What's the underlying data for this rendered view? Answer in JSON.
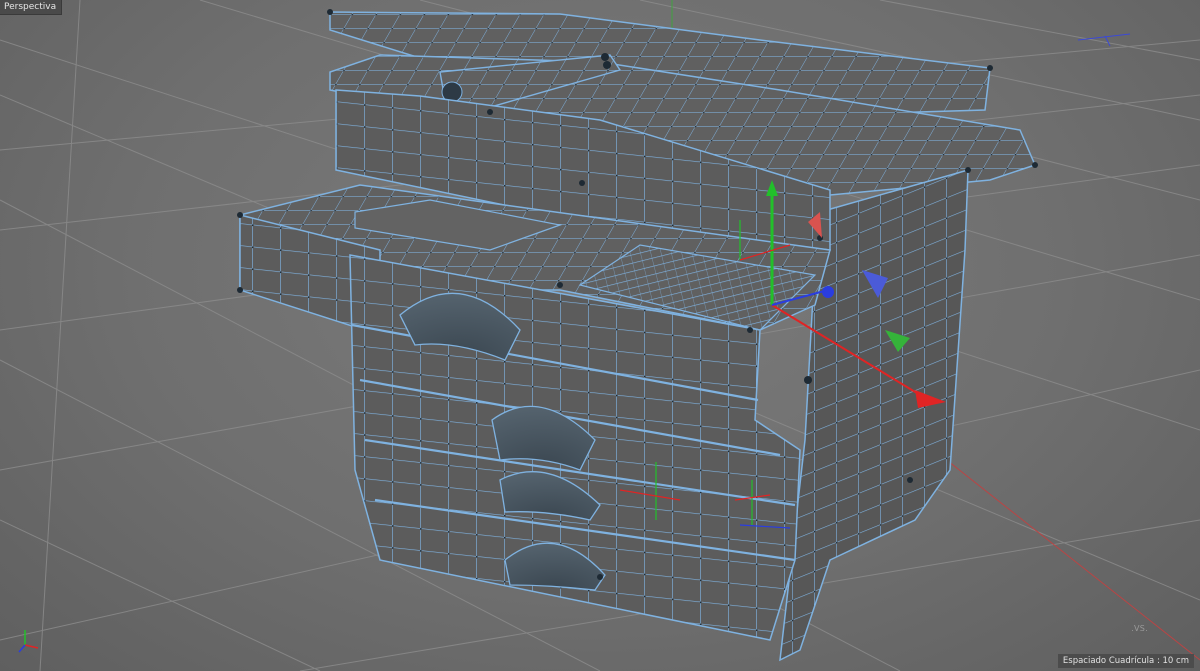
{
  "viewport": {
    "label": "Perspectiva",
    "grid_spacing_label": "Espaciado Cuadrícula : 10 cm",
    "corner_mark": ".VS."
  },
  "colors": {
    "background": "#6e6e6e",
    "grid_lines": "#8a8a8a",
    "mesh_face": "#5e5e5e",
    "wireframe": "#6fa8dc",
    "vertex": "#1f2a33",
    "axis_x": "#e02424",
    "axis_y": "#22c02a",
    "axis_z": "#2a3de0"
  },
  "icons": {
    "world_axis": "world-axis-icon",
    "move_gizmo": "move-gizmo-icon",
    "rotation_handles": "rotation-handle-icon"
  },
  "object": {
    "description_visible": "none"
  }
}
